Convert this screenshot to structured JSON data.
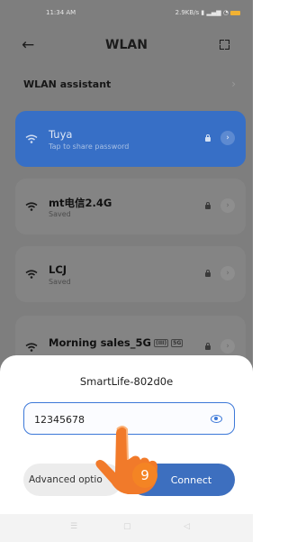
{
  "status": {
    "time": "11:34 AM",
    "speed": "2.9KB/s",
    "battery_color": "#f2b233"
  },
  "header": {
    "title": "WLAN",
    "back_icon": "arrow-left-icon",
    "scan_icon": "qr-scan-icon"
  },
  "assistant": {
    "label": "WLAN assistant"
  },
  "networks": [
    {
      "name": "Tuya",
      "sub": "Tap to share password",
      "active": true
    },
    {
      "name": "mt电信2.4G",
      "sub": "Saved"
    },
    {
      "name": "LCJ",
      "sub": "Saved"
    },
    {
      "name": "Morning sales_5G",
      "badges": [
        "(III)",
        "5G"
      ]
    }
  ],
  "dialog": {
    "ssid": "SmartLife-802d0e",
    "password": "12345678",
    "advanced_label": "Advanced optio",
    "connect_label": "Connect"
  },
  "step_badge": "9",
  "colors": {
    "accent": "#3d6fbf",
    "active_card": "#376fc6",
    "step": "#f48424",
    "hand": "#f17a2a"
  }
}
